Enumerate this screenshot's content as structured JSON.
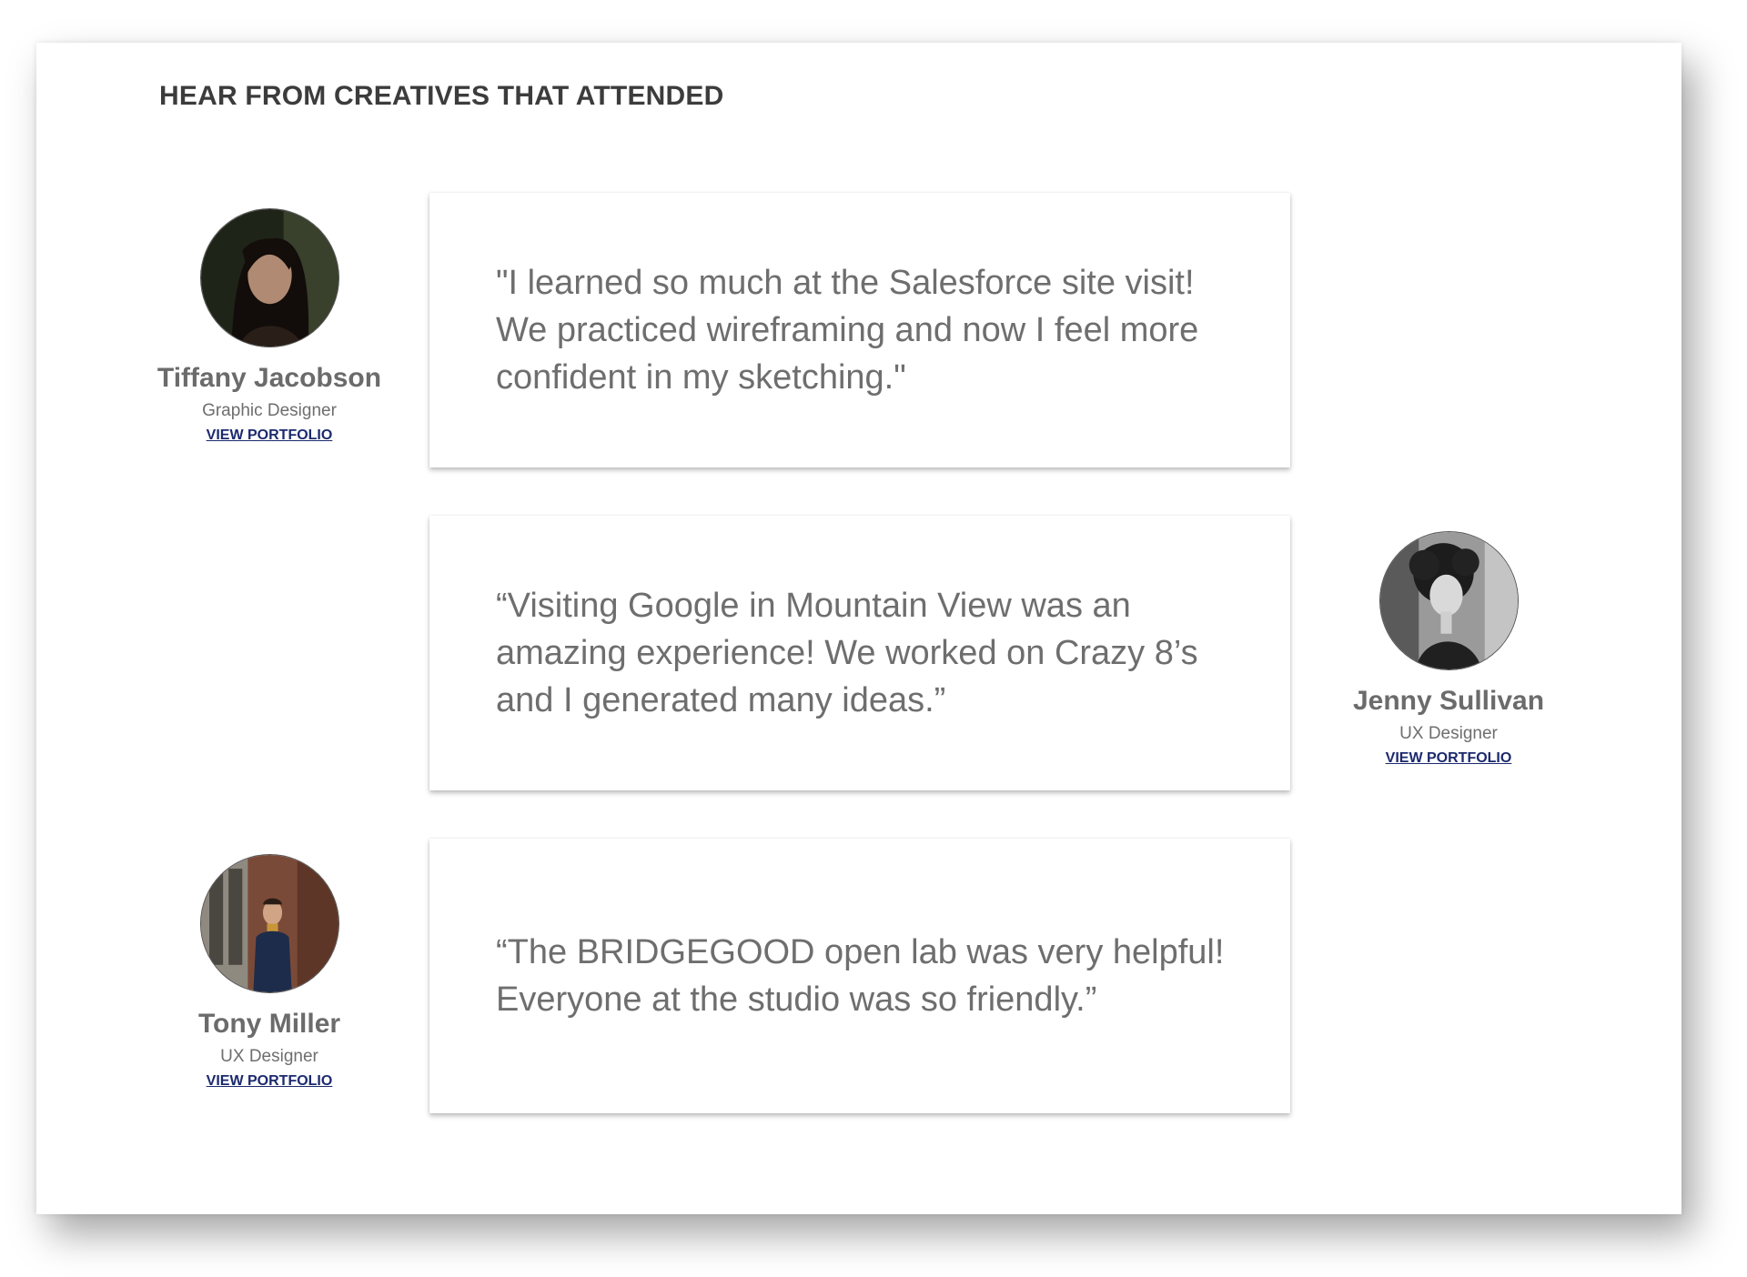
{
  "section": {
    "heading": "HEAR FROM CREATIVES THAT ATTENDED"
  },
  "testimonials": [
    {
      "quote": "\"I learned so much at the Salesforce site visit! We practiced wireframing and now I feel more confident in my sketching.\"",
      "name": "Tiffany Jacobson",
      "role": "Graphic Designer",
      "link_label": "VIEW PORTFOLIO"
    },
    {
      "quote": "“Visiting Google in Mountain View was an amazing experience! We worked on Crazy 8’s and I generated many ideas.”",
      "name": "Jenny Sullivan",
      "role": "UX Designer",
      "link_label": "VIEW PORTFOLIO"
    },
    {
      "quote": "“The BRIDGEGOOD open lab was very helpful! Everyone at the studio was so friendly.”",
      "name": "Tony Miller",
      "role": "UX Designer",
      "link_label": "VIEW PORTFOLIO"
    }
  ],
  "colors": {
    "heading": "#3c3c3c",
    "quote_text": "#6e6e6e",
    "link": "#1c2a6e"
  }
}
